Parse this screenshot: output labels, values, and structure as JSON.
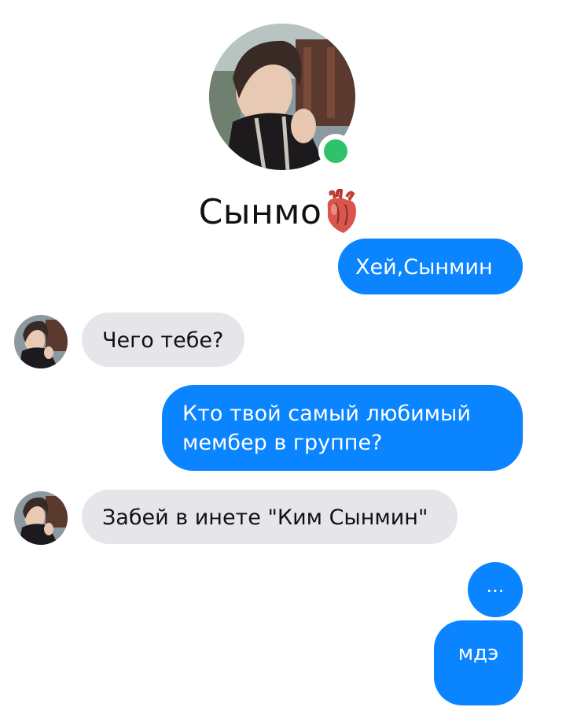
{
  "contact": {
    "name": "Сынмо",
    "status": "online",
    "heart_emoji": "anatomical-heart-icon"
  },
  "colors": {
    "outgoing": "#0a84ff",
    "incoming": "#e6e6ea",
    "online": "#2fc26a"
  },
  "messages": [
    {
      "from": "me",
      "text": "Хей,Сынмин"
    },
    {
      "from": "contact",
      "text": "Чего тебе?"
    },
    {
      "from": "me",
      "text": "Кто твой самый любимый мембер в группе?"
    },
    {
      "from": "contact",
      "text": "Забей в инете \"Ким Сынмин\""
    },
    {
      "from": "me",
      "text": "..."
    },
    {
      "from": "me",
      "text": "мдэ"
    }
  ]
}
